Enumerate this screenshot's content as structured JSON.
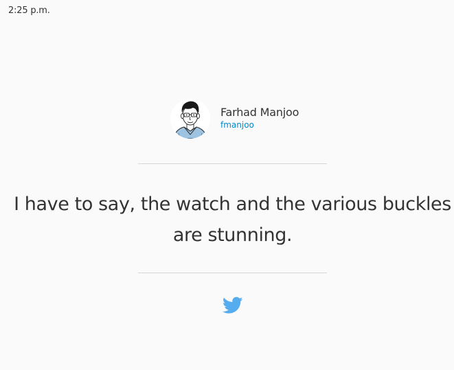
{
  "timestamp": "2:25 p.m.",
  "author": {
    "name": "Farhad Manjoo",
    "handle": "fmanjoo",
    "avatar_icon": "avatar-illustration"
  },
  "quote": {
    "text": "I have to say, the watch and the various buckles are stunning."
  },
  "social": {
    "icon": "twitter-bird-icon",
    "color": "#55acee"
  },
  "colors": {
    "background": "#fafafa",
    "text": "#333333",
    "handle": "#0088cc",
    "divider": "#d6d6d6"
  }
}
